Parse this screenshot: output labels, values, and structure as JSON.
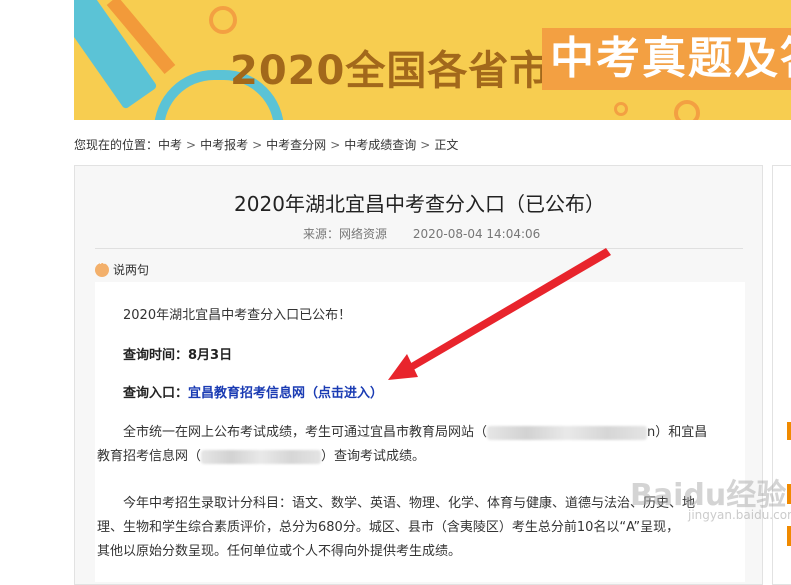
{
  "banner": {
    "title_left": "2020全国各省市",
    "title_right": "中考真题及答"
  },
  "breadcrumb": {
    "prefix": "您现在的位置：",
    "items": [
      "中考",
      "中考报考",
      "中考查分网",
      "中考成绩查询",
      "正文"
    ],
    "separator": ">"
  },
  "article": {
    "title": "2020年湖北宜昌中考查分入口（已公布）",
    "source": "来源：网络资源",
    "date": "2020-08-04 14:04:06",
    "comment_label": "说两句",
    "intro": "2020年湖北宜昌中考查分入口已公布！",
    "query_time_label": "查询时间：8月3日",
    "query_entry_label": "查询入口：",
    "query_entry_link": "宜昌教育招考信息网（点击进入）",
    "para1_a": "全市统一在网上公布考试成绩，考生可通过宜昌市教育局网站（",
    "para1_b": "n）和宜昌",
    "para1_c": "教育招考信息网（",
    "para1_d": "）查询考试成绩。",
    "para2_a": "今年中考招生录取计分科目：语文、数学、英语、物理、化学、体育与健康、道德与法治、历史、地",
    "para2_b": "理、生物和学生综合素质评价，总分为680分。城区、县市（含夷陵区）考生总分前10名以“A”呈现，",
    "para2_c": "其他以原始分数呈现。任何单位或个人不得向外提供考生成绩。"
  },
  "watermark": {
    "text": "Baidu经验",
    "sub": "jingyan.baidu.com"
  },
  "colors": {
    "banner_bg": "#f7cd50",
    "banner_accent": "#f3a042",
    "link": "#1a3bb3",
    "arrow": "#e8242c"
  }
}
